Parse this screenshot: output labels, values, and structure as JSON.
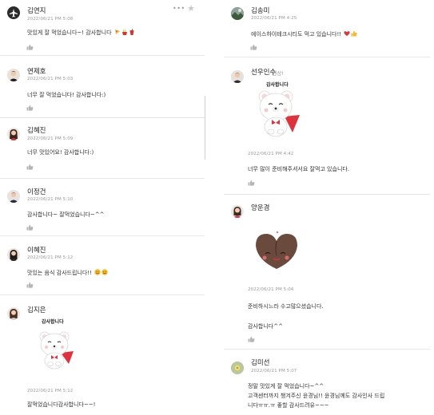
{
  "left": {
    "comments": [
      {
        "name": "김연지",
        "date": "2022/06/21 PM 5:08",
        "text": "맛있게 잘 먹었습니다~! 감사합니다",
        "emoji": [
          "pizza",
          "fries",
          "drink"
        ]
      },
      {
        "name": "연제호",
        "date": "2022/06/21 PM 5:03",
        "text": "너무 잘 먹었습니다! 감사합니다:)"
      },
      {
        "name": "김혜진",
        "date": "2022/06/21 PM 5:09",
        "text": "너무 맛있어요! 감사합니다:)"
      },
      {
        "name": "이정건",
        "date": "2022/06/21 PM 5:10",
        "text": "감사합니다~ 잘먹었습니다~^^"
      },
      {
        "name": "이혜진",
        "date": "2022/06/21 PM 5:12",
        "text": "맛있는 음식 감사드립니다!!",
        "emoji": [
          "smile",
          "smile"
        ]
      },
      {
        "name": "김지은",
        "sticker_text": "감사합니다",
        "date": "2022/06/21 PM 5:12",
        "text": "잘먹었습니다감사합니다~~!"
      }
    ]
  },
  "right": {
    "comments": [
      {
        "name": "김송미",
        "date": "2022/06/21 PM 4:25",
        "text": "에이스하이테크시티도 먹고 있습니다!!",
        "emoji": [
          "heart",
          "thumbs"
        ]
      },
      {
        "name": "선우인수",
        "subname": "- 원상!",
        "sticker_text": "감사합니다",
        "date": "2022/06/21 PM 4:42",
        "text": "너무 많이 준비해주셔서요 잘먹고 있습니다."
      },
      {
        "name": "양운경",
        "date": "2022/06/21 PM 5:04",
        "text": "준비하시느라 수고많으셨습니다.",
        "text2": "감사합니다^^"
      },
      {
        "name": "김미선",
        "date": "2022/06/21 PM 5:07",
        "text": "정말 맛있게 잘 먹었습니다~^^",
        "text2": "고객센터까지 챙겨주신 윤경님!! 윤경님께도 감사인사 드립",
        "text3": "니다ㅠㅠ.ㅠ 좋할 감사드려유~~~"
      }
    ]
  },
  "controls": {
    "more": "• • •",
    "star": "★"
  },
  "colors": {
    "accent_red": "#e0323c",
    "text": "#333333",
    "meta": "#999999",
    "divider": "#e7e7e7"
  }
}
